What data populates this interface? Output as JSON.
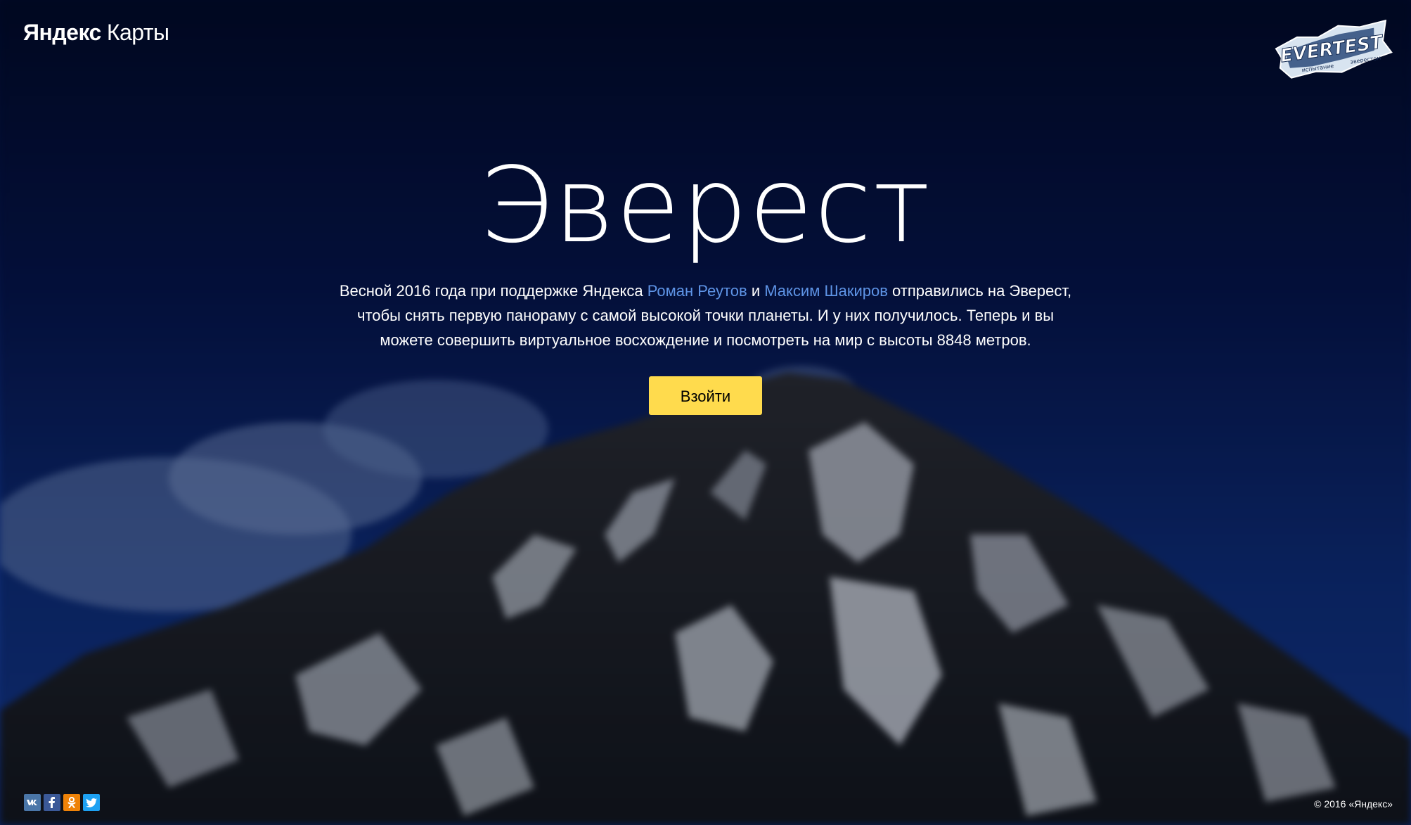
{
  "logo": {
    "brand": "Яндекс",
    "product": "Карты"
  },
  "badge": {
    "main": "EVERTEST",
    "left_sub": "испытание",
    "right_sub": "эверестом"
  },
  "hero": {
    "title": "Эверест",
    "text_part1": "Весной 2016 года при поддержке Яндекса ",
    "link1": "Роман Реутов",
    "text_part2": " и ",
    "link2": "Максим Шакиров",
    "text_part3": " отправились на Эверест, чтобы снять первую панораму с самой высокой точки планеты. И у них получилось. Теперь и вы можете совершить виртуальное восхождение и посмотреть на мир с высоты 8848 метров.",
    "button_label": "Взойти"
  },
  "social": [
    {
      "name": "vk",
      "glyph": "vk",
      "color": "#4a76a8"
    },
    {
      "name": "facebook",
      "glyph": "f",
      "color": "#3b5998"
    },
    {
      "name": "odnoklassniki",
      "glyph": "ok",
      "color": "#ee8208"
    },
    {
      "name": "twitter",
      "glyph": "t",
      "color": "#1da1f2"
    }
  ],
  "footer": {
    "copyright": "© 2016 «Яндекс»"
  },
  "colors": {
    "accent_button": "#ffdb4d",
    "link": "#5e94e6",
    "sky_top": "#020a26",
    "sky_bottom": "#123078"
  }
}
